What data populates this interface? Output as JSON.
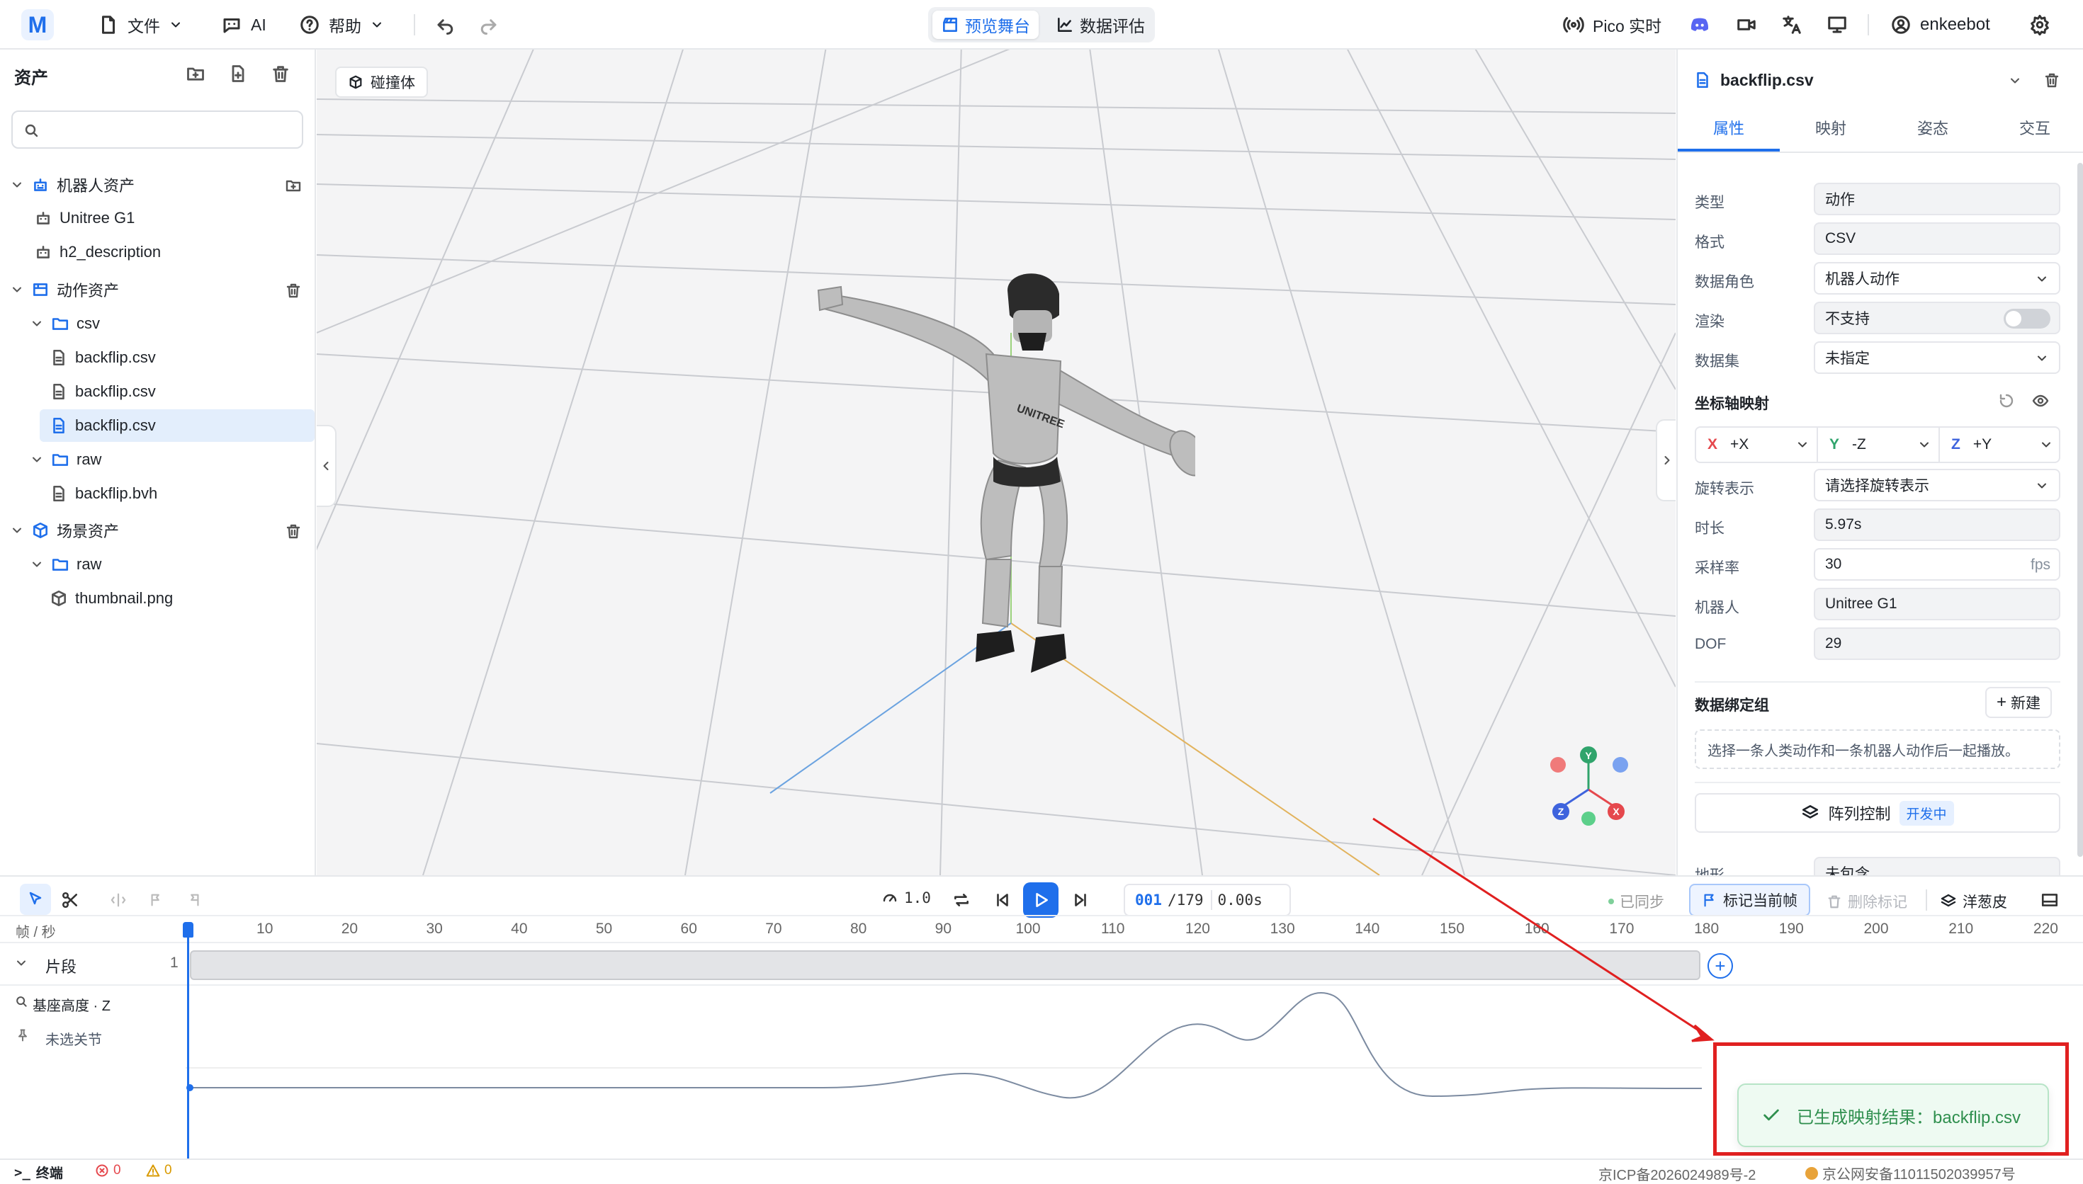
{
  "topbar": {
    "logo": "M",
    "file_menu": "文件",
    "ai_menu": "AI",
    "help_menu": "帮助",
    "tabs": [
      {
        "label": "预览舞台",
        "active": true
      },
      {
        "label": "数据评估",
        "active": false
      }
    ],
    "pico_label": "Pico 实时",
    "username": "enkeebot",
    "icons": [
      "undo-icon",
      "redo-icon",
      "discord-icon",
      "video-icon",
      "translate-icon",
      "monitor-icon",
      "user-icon",
      "gear-icon"
    ]
  },
  "assets": {
    "title": "资产",
    "search_placeholder": "",
    "robot_group": {
      "label": "机器人资产",
      "items": [
        "Unitree G1",
        "h2_description"
      ]
    },
    "motion_group": {
      "label": "动作资产",
      "folders": [
        {
          "label": "csv",
          "items": [
            "backflip.csv",
            "backflip.csv",
            "backflip.csv"
          ],
          "selected_index": 2
        },
        {
          "label": "raw",
          "items": [
            "backflip.bvh"
          ]
        }
      ]
    },
    "scene_group": {
      "label": "场景资产",
      "folders": [
        {
          "label": "raw",
          "items": [
            "thumbnail.png"
          ]
        }
      ]
    }
  },
  "viewport": {
    "collider_button": "碰撞体",
    "robot_brand": "UNITREE",
    "gizmo": {
      "y": "Y",
      "x": "X",
      "z": "Z"
    }
  },
  "inspector": {
    "title": "backflip.csv",
    "tabs": [
      "属性",
      "映射",
      "姿态",
      "交互"
    ],
    "active_tab": 0,
    "props": [
      {
        "label": "类型",
        "value": "动作"
      },
      {
        "label": "格式",
        "value": "CSV"
      },
      {
        "label": "数据角色",
        "value": "机器人动作",
        "dropdown": true
      },
      {
        "label": "渲染",
        "value": "不支持",
        "toggle": true
      },
      {
        "label": "数据集",
        "value": "未指定",
        "dropdown": true
      }
    ],
    "axis_mapping_title": "坐标轴映射",
    "axis_mapping": [
      {
        "axis": "X",
        "value": "+X",
        "color": "#e5484d"
      },
      {
        "axis": "Y",
        "value": "-Z",
        "color": "#30a46c"
      },
      {
        "axis": "Z",
        "value": "+Y",
        "color": "#3e63dd"
      }
    ],
    "props2": [
      {
        "label": "旋转表示",
        "value": "请选择旋转表示",
        "dropdown": true
      },
      {
        "label": "时长",
        "value": "5.97s"
      },
      {
        "label": "采样率",
        "value": "30",
        "unit": "fps"
      },
      {
        "label": "机器人",
        "value": "Unitree G1"
      },
      {
        "label": "DOF",
        "value": "29"
      }
    ],
    "binding_title": "数据绑定组",
    "new_button": "新建",
    "binding_hint": "选择一条人类动作和一条机器人动作后一起播放。",
    "array_control": "阵列控制",
    "array_badge": "开发中",
    "cut_label": "地形",
    "cut_value": "未包含"
  },
  "timeline": {
    "speed": "1.0",
    "frame_current": "001",
    "frame_total": "/179",
    "time": "0.00s",
    "sync_label": "已同步",
    "mark_button": "标记当前帧",
    "delete_mark": "删除标记",
    "onion_skin": "洋葱皮",
    "frame_sec_label": "帧 / 秒",
    "ticks": [
      1,
      10,
      20,
      30,
      40,
      50,
      60,
      70,
      80,
      90,
      100,
      110,
      120,
      130,
      140,
      150,
      160,
      170,
      180,
      190,
      200,
      210,
      220
    ],
    "track_label": "片段",
    "track_count": "1",
    "curve_label": "基座高度 · Z",
    "joint_label": "未选关节"
  },
  "toast": {
    "message": "已生成映射结果：backflip.csv"
  },
  "statusbar": {
    "terminal": "终端",
    "errors": "0",
    "warnings": "0",
    "icp": "京ICP备2026024989号-2",
    "police": "京公网安备11011502039957号"
  },
  "colors": {
    "accent": "#1f6feb",
    "annotation": "#e02020",
    "toast_green": "#2f8f4e"
  }
}
